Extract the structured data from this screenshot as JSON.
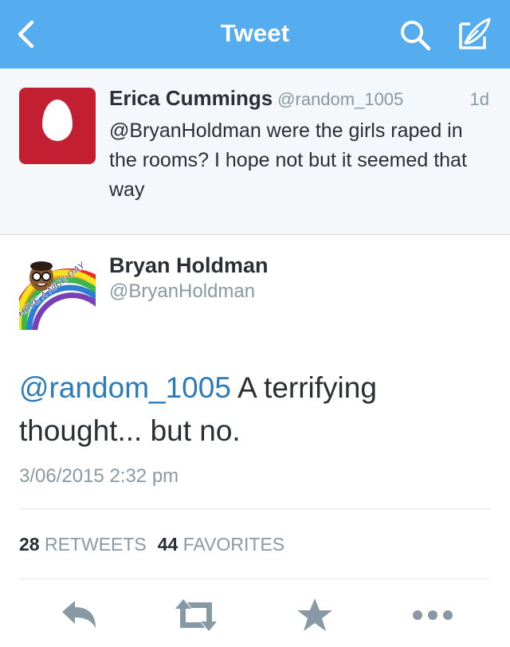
{
  "navbar": {
    "title": "Tweet",
    "color": "#55acee",
    "icons": [
      "chevron-left-icon",
      "search-icon",
      "compose-icon"
    ]
  },
  "parent_tweet": {
    "name": "Erica Cummings",
    "handle": "@random_1005",
    "time": "1d",
    "text": "@BryanHoldman were the girls raped in the rooms? I hope not but it seemed that way",
    "avatar_color": "#c21f33"
  },
  "main_tweet": {
    "name": "Bryan Holdman",
    "handle": "@BryanHoldman",
    "avatar_text": "HAVE A NICE DAY",
    "mention": "@random_1005",
    "text": " A terrifying thought... but no.",
    "timestamp": "3/06/2015 2:32 pm",
    "retweets_count": "28",
    "retweets_label": "RETWEETS",
    "favorites_count": "44",
    "favorites_label": "FAVORITES"
  },
  "actions": [
    "reply-icon",
    "retweet-icon",
    "favorite-icon",
    "more-icon"
  ],
  "colors": {
    "link": "#2b7bb9",
    "muted": "#8899a6",
    "text": "#292f33",
    "action": "#8899a6"
  }
}
